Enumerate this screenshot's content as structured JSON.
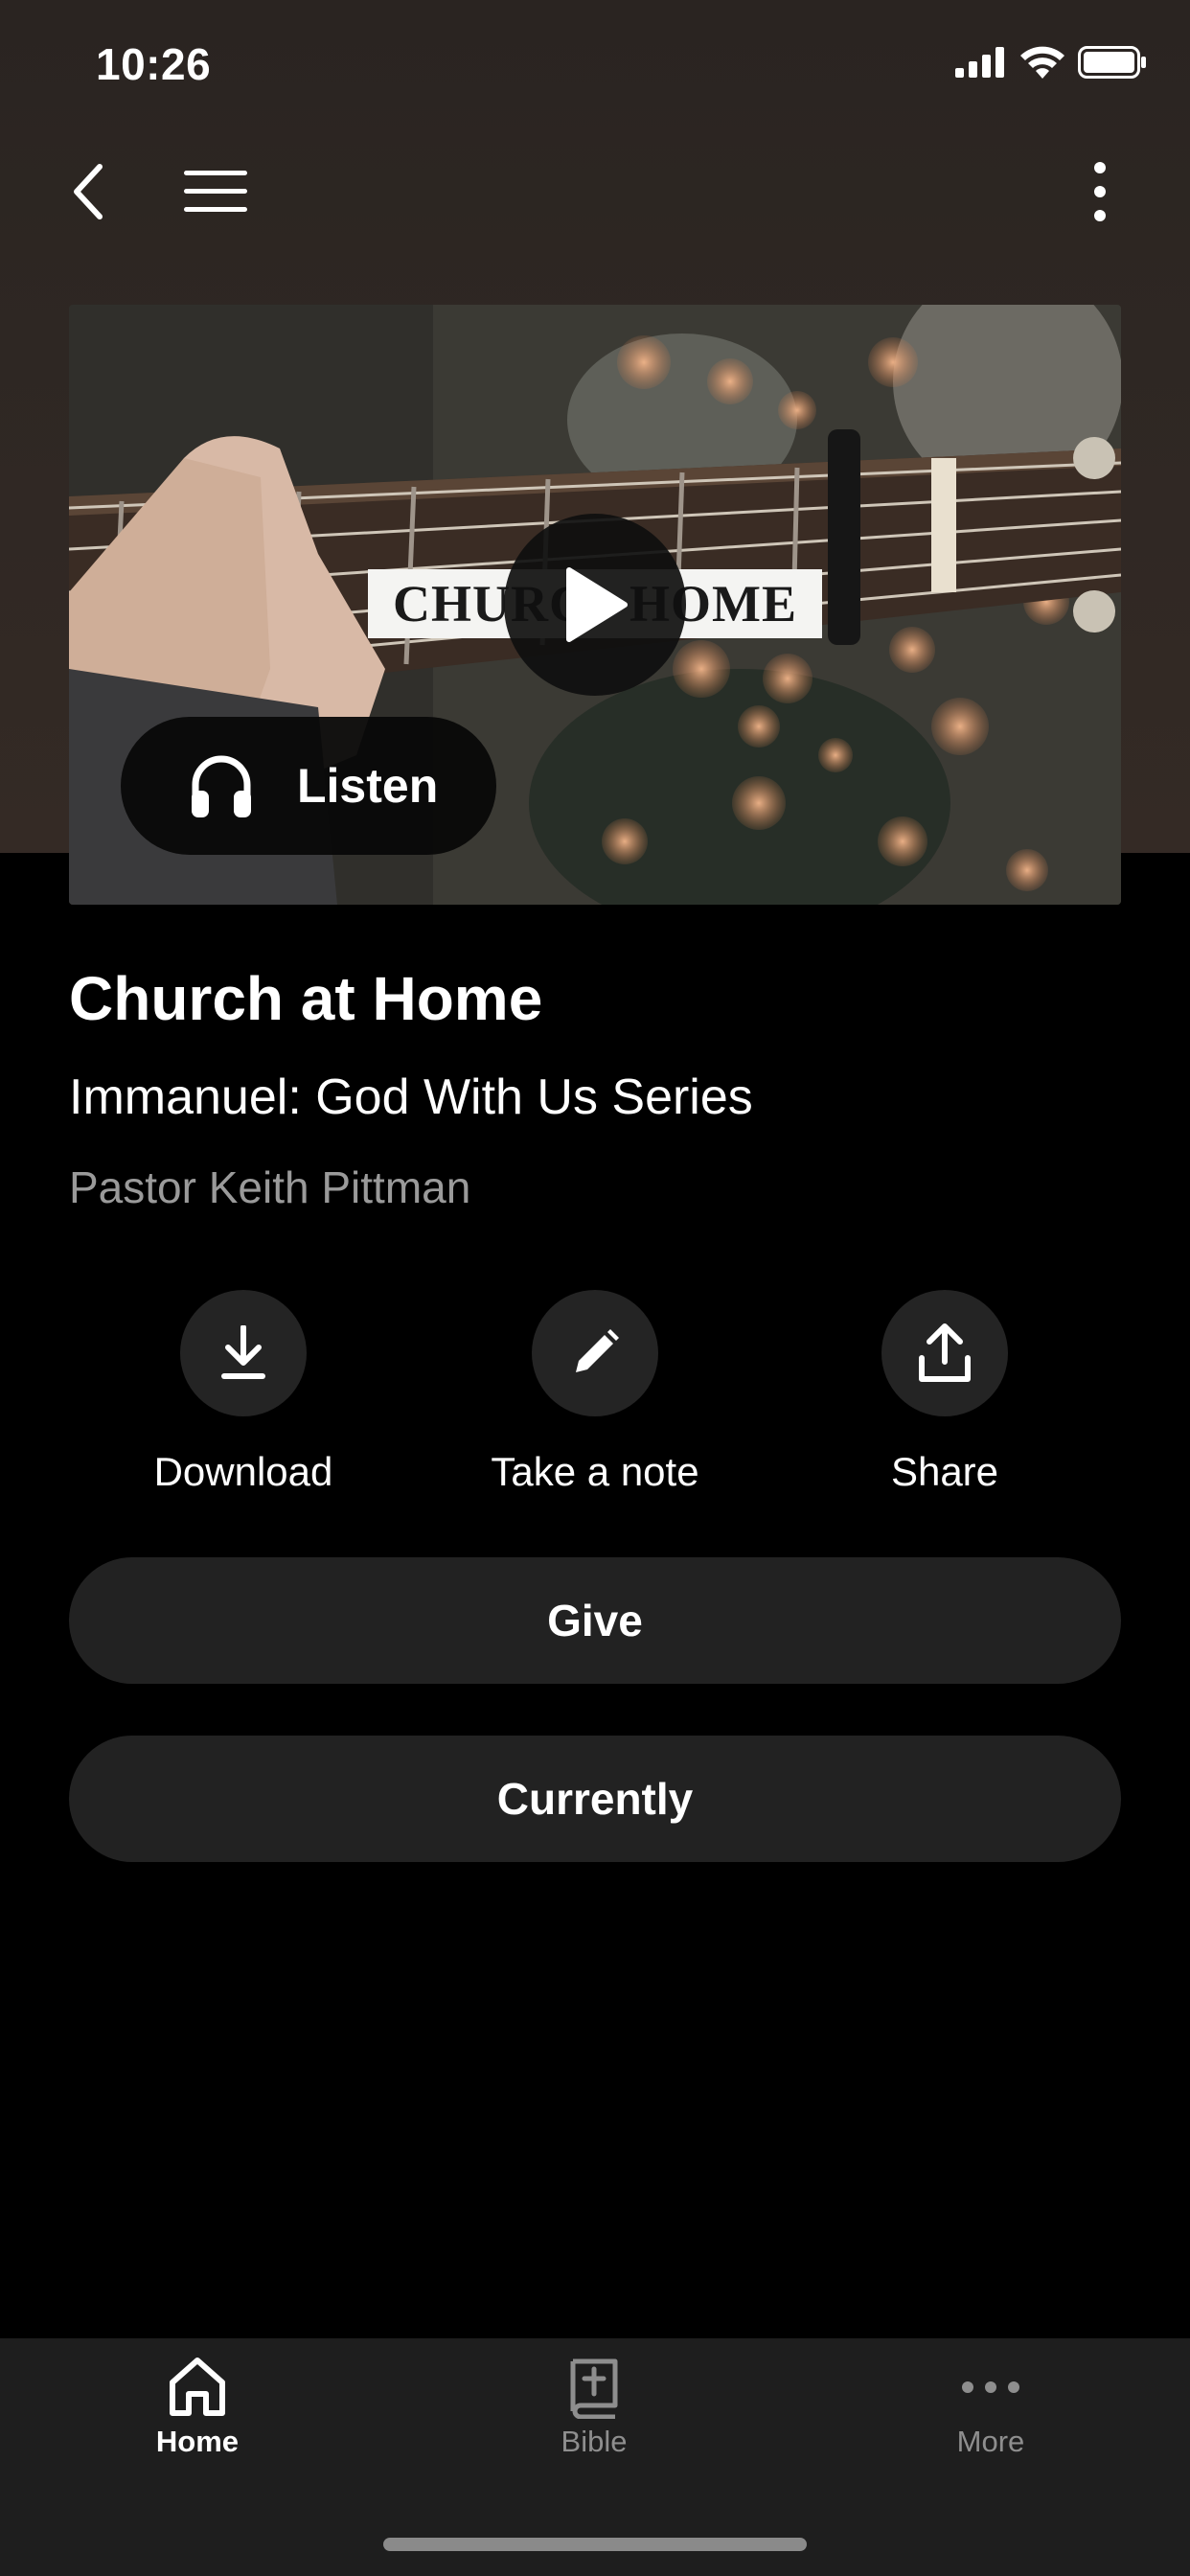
{
  "status_bar": {
    "time": "10:26"
  },
  "video": {
    "title_card_left": "CHURC",
    "title_card_right": "HOME",
    "listen_label": "Listen"
  },
  "content": {
    "title": "Church at Home",
    "subtitle": "Immanuel: God With Us Series",
    "speaker": "Pastor Keith Pittman"
  },
  "actions": [
    {
      "label": "Download",
      "icon": "download-icon"
    },
    {
      "label": "Take a note",
      "icon": "pencil-icon"
    },
    {
      "label": "Share",
      "icon": "share-icon"
    }
  ],
  "buttons": {
    "give": "Give",
    "currently": "Currently"
  },
  "tab_bar": {
    "items": [
      {
        "label": "Home",
        "icon": "home-icon",
        "active": true
      },
      {
        "label": "Bible",
        "icon": "bible-icon",
        "active": false
      },
      {
        "label": "More",
        "icon": "more-dots-icon",
        "active": false
      }
    ]
  },
  "colors": {
    "background": "#000000",
    "hero_background": "#2e2723",
    "button_fill": "#222222",
    "tab_bar": "#1e1e1e",
    "active_tab": "#ffffff",
    "inactive_tab": "#8e8e8e",
    "speaker_text": "#9a9a9a"
  }
}
